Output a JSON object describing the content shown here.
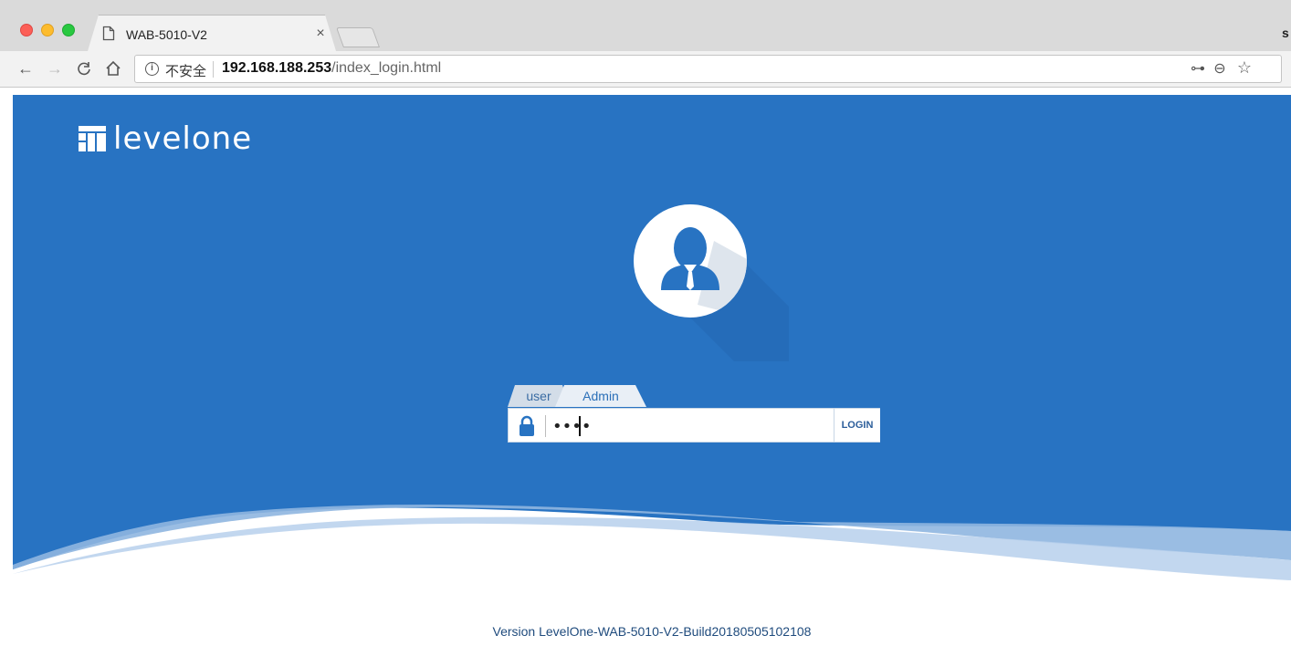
{
  "browser": {
    "tab_title": "WAB-5010-V2",
    "tab_close": "×",
    "edge_char": "s",
    "nav": {
      "back": "←",
      "forward": "→",
      "reload": "C",
      "home": "⌂"
    },
    "omnibox": {
      "info": "i",
      "security_label": "不安全",
      "url_host": "192.168.188.253",
      "url_path": "/index_login.html",
      "key_icon": "⊶",
      "zoom_icon": "⊖",
      "star_icon": "☆"
    }
  },
  "page": {
    "brand": "levelone",
    "tabs": [
      {
        "label": "user"
      },
      {
        "label": "Admin"
      }
    ],
    "password_value": "1234",
    "login_button": "LOGIN",
    "version": "Version LevelOne-WAB-5010-V2-Build20180505102108"
  },
  "colors": {
    "brand_blue": "#2873c2",
    "wave_light": "#8fb6e0"
  }
}
